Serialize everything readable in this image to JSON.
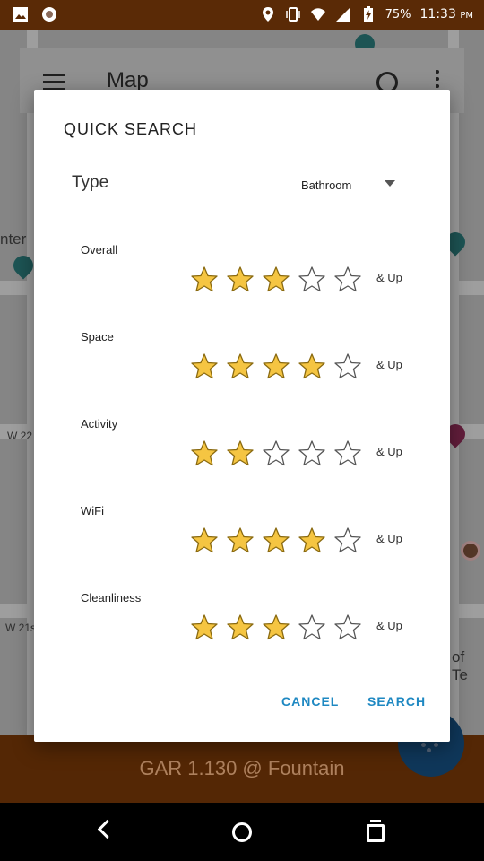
{
  "status_bar": {
    "battery": "75%",
    "time": "11:33",
    "ampm": "PM"
  },
  "app_bar": {
    "title": "Map"
  },
  "map": {
    "labels": [
      "nter",
      "W 22",
      "W 21s",
      "of Te"
    ]
  },
  "bottom_bar": {
    "text": "GAR 1.130 @ Fountain"
  },
  "dialog": {
    "title": "QUICK SEARCH",
    "type_label": "Type",
    "type_value": "Bathroom",
    "ratings": [
      {
        "label": "Overall",
        "value": 3,
        "max": 5,
        "suffix": "& Up"
      },
      {
        "label": "Space",
        "value": 4,
        "max": 5,
        "suffix": "& Up"
      },
      {
        "label": "Activity",
        "value": 2,
        "max": 5,
        "suffix": "& Up"
      },
      {
        "label": "WiFi",
        "value": 4,
        "max": 5,
        "suffix": "& Up"
      },
      {
        "label": "Cleanliness",
        "value": 3,
        "max": 5,
        "suffix": "& Up"
      }
    ],
    "cancel_label": "CANCEL",
    "search_label": "SEARCH"
  },
  "colors": {
    "accent": "#1e88c2",
    "star_fill": "#f5c542",
    "status_bar": "#5a2a06"
  }
}
